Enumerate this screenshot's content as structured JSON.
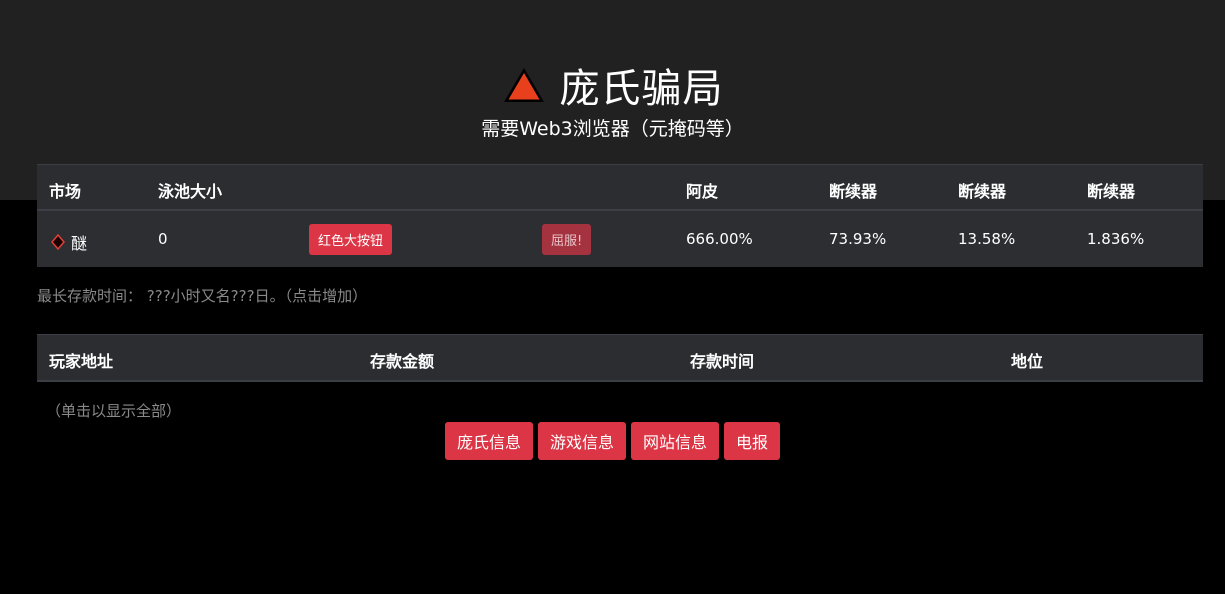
{
  "header": {
    "title": "庞氏骗局",
    "subtitle": "需要Web3浏览器（元掩码等）",
    "logo_icon": "red-triangle-icon",
    "background": "#212121"
  },
  "market_table": {
    "columns": [
      "市场",
      "泳池大小",
      "阿皮",
      "断续器",
      "断续器",
      "断续器"
    ],
    "row": {
      "coin_icon": "diamond-icon",
      "coin_name": "醚",
      "pool_size": "0",
      "big_button_label": "红色大按钮",
      "surrender_label": "屈服!",
      "apy": "666.00%",
      "breaker_1": "73.93%",
      "breaker_2": "13.58%",
      "breaker_3": "1.836%"
    }
  },
  "deposit_info": {
    "label": "最长存款时间：",
    "value": "???小时又名???日。（点击增加）"
  },
  "player_table": {
    "columns": [
      "玩家地址",
      "存款金额",
      "存款时间",
      "地位"
    ]
  },
  "show_all_label": "（单击以显示全部）",
  "footer_buttons": [
    "庞氏信息",
    "游戏信息",
    "网站信息",
    "电报"
  ],
  "colors": {
    "accent_red": "#dc3545",
    "triangle": "#e8401c",
    "table_bg": "#2b2d31"
  }
}
